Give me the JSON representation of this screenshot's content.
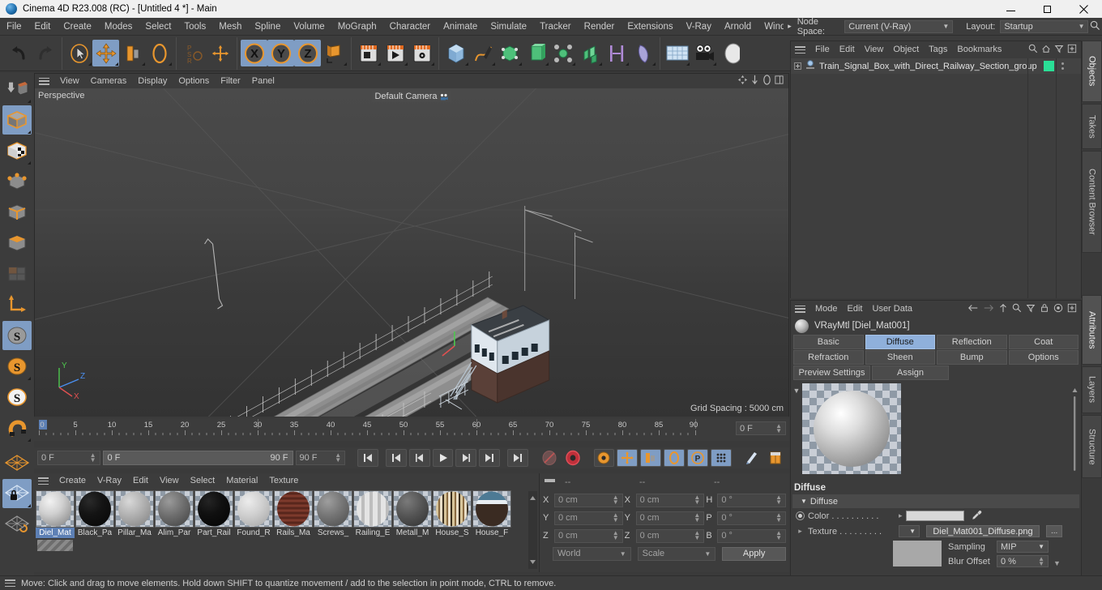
{
  "window": {
    "title": "Cinema 4D R23.008 (RC) - [Untitled 4 *] - Main",
    "minimize": "–",
    "maximize": "❐",
    "close": "✕"
  },
  "menubar": {
    "items": [
      "File",
      "Edit",
      "Create",
      "Modes",
      "Select",
      "Tools",
      "Mesh",
      "Spline",
      "Volume",
      "MoGraph",
      "Character",
      "Animate",
      "Simulate",
      "Tracker",
      "Render",
      "Extensions",
      "V-Ray",
      "Arnold",
      "Window"
    ],
    "overflow_arrow": "▸",
    "node_space_label": "Node Space:",
    "node_space_value": "Current (V-Ray)",
    "layout_label": "Layout:",
    "layout_value": "Startup",
    "search_icon": "search-icon"
  },
  "toolbar": {
    "groups": [
      {
        "name": "history",
        "buttons": [
          {
            "name": "undo",
            "icon": "undo-arrow",
            "selected": false,
            "corner": false
          },
          {
            "name": "redo",
            "icon": "redo-arrow",
            "selected": false,
            "corner": false
          }
        ]
      },
      {
        "name": "transform-tools",
        "buttons": [
          {
            "name": "live-selection",
            "icon": "cursor-circle",
            "selected": false,
            "corner": true
          },
          {
            "name": "move",
            "icon": "move-cross",
            "selected": true,
            "corner": true
          },
          {
            "name": "scale",
            "icon": "scale-box",
            "selected": false,
            "corner": true
          },
          {
            "name": "rotate",
            "icon": "rotate-ring",
            "selected": false,
            "corner": true
          }
        ]
      },
      {
        "name": "psr",
        "buttons": [
          {
            "name": "psr-lock",
            "icon": "psr-text",
            "selected": false,
            "corner": false
          },
          {
            "name": "world-object-axis",
            "icon": "axis-cross",
            "selected": false,
            "corner": false
          }
        ]
      },
      {
        "name": "axis-locks",
        "buttons": [
          {
            "name": "x-axis-lock",
            "icon": "x-circle",
            "selected": true,
            "corner": false
          },
          {
            "name": "y-axis-lock",
            "icon": "y-circle",
            "selected": true,
            "corner": false
          },
          {
            "name": "z-axis-lock",
            "icon": "z-circle",
            "selected": true,
            "corner": false
          },
          {
            "name": "world-coordinate-system",
            "icon": "world-cube",
            "selected": false,
            "corner": true
          }
        ]
      },
      {
        "name": "render",
        "buttons": [
          {
            "name": "render-view",
            "icon": "render-frame",
            "selected": false,
            "corner": true
          },
          {
            "name": "render-to-picture-viewer",
            "icon": "render-play",
            "selected": false,
            "corner": true
          },
          {
            "name": "edit-render-settings",
            "icon": "render-gear",
            "selected": false,
            "corner": true
          }
        ]
      },
      {
        "name": "objects",
        "buttons": [
          {
            "name": "add-cube-object",
            "icon": "cube-blue",
            "selected": false,
            "corner": true
          },
          {
            "name": "add-spline",
            "icon": "pen-spline",
            "selected": false,
            "corner": true
          },
          {
            "name": "add-generator",
            "icon": "green-cage-cube",
            "selected": false,
            "corner": true
          },
          {
            "name": "add-spline-generator",
            "icon": "green-extrude",
            "selected": false,
            "corner": true
          },
          {
            "name": "add-modeling-object",
            "icon": "green-array",
            "selected": false,
            "corner": true
          },
          {
            "name": "add-deformer",
            "icon": "green-cluster",
            "selected": false,
            "corner": true
          },
          {
            "name": "add-scene-object",
            "icon": "bracket-pipe",
            "selected": false,
            "corner": true
          },
          {
            "name": "add-field",
            "icon": "field-shape",
            "selected": false,
            "corner": true
          }
        ]
      },
      {
        "name": "scene",
        "buttons": [
          {
            "name": "add-floor-environment",
            "icon": "floor-grid",
            "selected": false,
            "corner": true
          },
          {
            "name": "add-camera",
            "icon": "camera-icon",
            "selected": false,
            "corner": true
          },
          {
            "name": "add-light",
            "icon": "light-bulb",
            "selected": false,
            "corner": false
          }
        ]
      }
    ]
  },
  "left_tools": [
    {
      "name": "make-editable",
      "icon": "make-editable-icon",
      "selected": false,
      "corner": true
    },
    {
      "name": "model-mode",
      "icon": "model-cube-icon",
      "selected": true,
      "corner": true
    },
    {
      "name": "texture-mode",
      "icon": "texture-cube-icon",
      "selected": false,
      "corner": true
    },
    {
      "name": "points-mode",
      "icon": "points-cube-icon",
      "selected": false,
      "corner": false
    },
    {
      "name": "edges-mode",
      "icon": "edges-cube-icon",
      "selected": false,
      "corner": false
    },
    {
      "name": "polygons-mode",
      "icon": "polygons-cube-icon",
      "selected": false,
      "corner": false
    },
    {
      "name": "uv-mode",
      "icon": "uv-tiles-icon",
      "selected": false,
      "corner": false
    },
    {
      "name": "axis-modify-mode",
      "icon": "axis-arrows-icon",
      "selected": false,
      "corner": false
    },
    {
      "name": "enable-snapping",
      "icon": "snap-s-gray-icon",
      "selected": true,
      "corner": false
    },
    {
      "name": "snap-settings",
      "icon": "snap-s-orange-icon",
      "selected": false,
      "corner": true
    },
    {
      "name": "quantize",
      "icon": "snap-s-white-icon",
      "selected": false,
      "corner": false
    },
    {
      "name": "magnet-tool",
      "icon": "magnet-icon",
      "selected": false,
      "corner": true
    },
    {
      "name": "workplane",
      "icon": "workplane-orange-icon",
      "selected": false,
      "corner": false
    },
    {
      "name": "lock-workplane",
      "icon": "workplane-lock-icon",
      "selected": true,
      "corner": true
    },
    {
      "name": "planar-workplane",
      "icon": "workplane-rotate-icon",
      "selected": false,
      "corner": false
    }
  ],
  "viewport": {
    "menu": [
      "View",
      "Cameras",
      "Display",
      "Options",
      "Filter",
      "Panel"
    ],
    "label": "Perspective",
    "camera": "Default Camera",
    "camera_icon": "camera-small-icon",
    "grid_spacing": "Grid Spacing : 5000 cm",
    "axis": {
      "x": "X",
      "y": "Y",
      "z": "Z",
      "x_color": "#e05050",
      "y_color": "#4ec94e",
      "z_color": "#4a8ff0"
    },
    "right_icons": [
      "move-view-icon",
      "pan-view-icon",
      "rotate-view-icon",
      "maximize-view-icon"
    ]
  },
  "timeline": {
    "ticks": [
      "0",
      "5",
      "10",
      "15",
      "20",
      "25",
      "30",
      "35",
      "40",
      "45",
      "50",
      "55",
      "60",
      "65",
      "70",
      "75",
      "80",
      "85",
      "90"
    ],
    "current_frame_field": "0 F"
  },
  "transport": {
    "frame_field": "0 F",
    "range_start": "0 F",
    "range_end": "90 F",
    "end_field": "90 F",
    "buttons": [
      {
        "name": "go-to-start",
        "icon": "skip-start-icon",
        "selected": false
      },
      {
        "name": "go-to-previous-key",
        "icon": "prev-key-icon",
        "selected": false
      },
      {
        "name": "step-back",
        "icon": "step-back-icon",
        "selected": false
      },
      {
        "name": "play",
        "icon": "play-icon",
        "selected": false
      },
      {
        "name": "step-forward",
        "icon": "step-forward-icon",
        "selected": false
      },
      {
        "name": "go-to-next-key",
        "icon": "next-key-icon",
        "selected": false
      },
      {
        "name": "go-to-end",
        "icon": "skip-end-icon",
        "selected": false
      },
      {
        "name": "record-active-objects",
        "icon": "record-disabled-icon",
        "selected": false
      },
      {
        "name": "autokeying",
        "icon": "autokey-red-icon",
        "selected": false
      },
      {
        "name": "keyframe-selection",
        "icon": "key-gear-icon",
        "selected": false
      },
      {
        "name": "position-key",
        "icon": "pos-key-icon",
        "selected": true
      },
      {
        "name": "scale-key",
        "icon": "scale-key-icon",
        "selected": true
      },
      {
        "name": "rotation-key",
        "icon": "rot-key-icon",
        "selected": true
      },
      {
        "name": "parameter-key",
        "icon": "param-key-icon",
        "selected": true
      },
      {
        "name": "point-level-animation",
        "icon": "pla-dots-icon",
        "selected": true
      },
      {
        "name": "motion-clip",
        "icon": "motion-clip-icon",
        "selected": false
      },
      {
        "name": "timeline-panel",
        "icon": "timeline-panel-icon",
        "selected": false
      }
    ]
  },
  "material_manager": {
    "menu": [
      "Create",
      "V-Ray",
      "Edit",
      "View",
      "Select",
      "Material",
      "Texture"
    ],
    "materials": [
      {
        "name": "Diel_Mat",
        "color": "#b9bec2",
        "selected": true,
        "pattern": "plain"
      },
      {
        "name": "Black_Pa",
        "color": "#0d0d0d",
        "selected": false,
        "pattern": "plain"
      },
      {
        "name": "Pillar_Ma",
        "color": "#a3a3a3",
        "selected": false,
        "pattern": "noise"
      },
      {
        "name": "Alim_Par",
        "color": "#6b6b6b",
        "selected": false,
        "pattern": "plain"
      },
      {
        "name": "Part_Rail",
        "color": "#080808",
        "selected": false,
        "pattern": "plain"
      },
      {
        "name": "Found_R",
        "color": "#c9c9c9",
        "selected": false,
        "pattern": "stripe"
      },
      {
        "name": "Rails_Ma",
        "color": "#6d3328",
        "selected": false,
        "pattern": "hstripe"
      },
      {
        "name": "Screws_",
        "color": "#6a6a6a",
        "selected": false,
        "pattern": "plain"
      },
      {
        "name": "Railing_E",
        "color": "#d0d0d0",
        "selected": false,
        "pattern": "vstripe"
      },
      {
        "name": "Metall_M",
        "color": "#4d4d4d",
        "selected": false,
        "pattern": "plain"
      },
      {
        "name": "House_S",
        "color": "#caa878",
        "selected": false,
        "pattern": "wood"
      },
      {
        "name": "House_F",
        "color": "#3b3027",
        "selected": false,
        "pattern": "band"
      }
    ]
  },
  "coordinates": {
    "header": [
      "--",
      "--",
      "--"
    ],
    "rows": [
      {
        "l1": "X",
        "v1": "0 cm",
        "l2": "X",
        "v2": "0 cm",
        "l3": "H",
        "v3": "0 °"
      },
      {
        "l1": "Y",
        "v1": "0 cm",
        "l2": "Y",
        "v2": "0 cm",
        "l3": "P",
        "v3": "0 °"
      },
      {
        "l1": "Z",
        "v1": "0 cm",
        "l2": "Z",
        "v2": "0 cm",
        "l3": "B",
        "v3": "0 °"
      }
    ],
    "system": "World",
    "mode": "Scale",
    "apply": "Apply"
  },
  "object_manager": {
    "menu": [
      "File",
      "Edit",
      "View",
      "Object",
      "Tags",
      "Bookmarks"
    ],
    "icons": [
      "search-icon",
      "home-icon",
      "filter-icon",
      "plus-box-icon"
    ],
    "object_name": "Train_Signal_Box_with_Direct_Railway_Section_group",
    "object_icon": "null-object-icon",
    "layer_color": "#2adf96",
    "dots_icon": "tag-dots-icon"
  },
  "attributes": {
    "menu": [
      "Mode",
      "Edit",
      "User Data"
    ],
    "icons": [
      "back-arrow-icon",
      "forward-arrow-icon",
      "up-arrow-icon",
      "search-icon",
      "filter-icon",
      "lock-icon",
      "target-icon",
      "plus-box-icon"
    ],
    "title": "VRayMtl [Diel_Mat001]",
    "tabs_row1": [
      "Basic",
      "Diffuse",
      "Reflection",
      "Coat"
    ],
    "tabs_row2": [
      "Refraction",
      "Sheen",
      "Bump",
      "Options"
    ],
    "tabs_row3": [
      "Preview Settings",
      "Assign"
    ],
    "selected_tab": "Diffuse",
    "section_title": "Diffuse",
    "group_title": "Diffuse",
    "properties": {
      "color_label": "Color . . . . . . . . . .",
      "color_value": "#d8d8d8",
      "eyedropper_icon": "eyedropper-icon",
      "texture_label": "Texture . . . . . . . . .",
      "texture_value": "Diel_Mat001_Diffuse.png",
      "texture_more": "...",
      "sampling_label": "Sampling",
      "sampling_value": "MIP",
      "blur_offset_label": "Blur Offset",
      "blur_offset_value": "0 %"
    }
  },
  "vertical_tabs_right": [
    {
      "label": "Objects",
      "selected": true
    },
    {
      "label": "Takes",
      "selected": false
    },
    {
      "label": "Content Browser",
      "selected": false
    },
    {
      "label": "Attributes",
      "selected": true
    },
    {
      "label": "Layers",
      "selected": false
    },
    {
      "label": "Structure",
      "selected": false
    }
  ],
  "statusbar": {
    "message": "Move: Click and drag to move elements. Hold down SHIFT to quantize movement / add to the selection in point mode, CTRL to remove."
  }
}
